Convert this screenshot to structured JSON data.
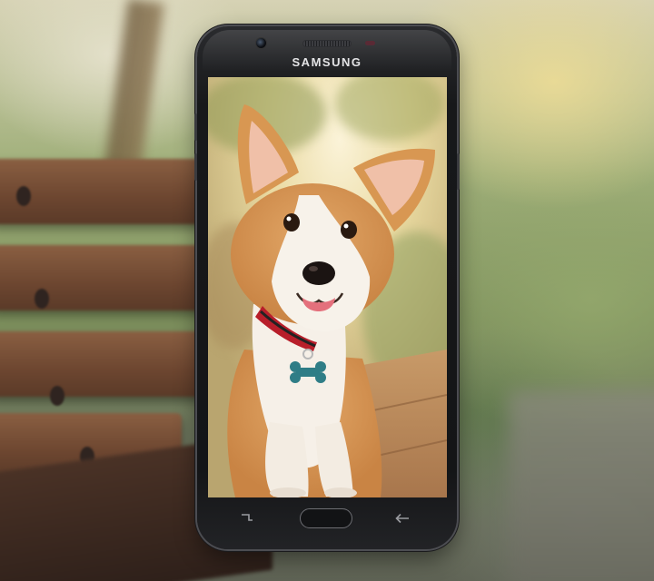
{
  "phone": {
    "brand": "SAMSUNG"
  },
  "icons": {
    "recent": "recent-apps-icon",
    "home": "home-button",
    "back": "back-arrow-icon"
  },
  "colors": {
    "phone_body": "#161719",
    "tag": "#2f7d86"
  }
}
